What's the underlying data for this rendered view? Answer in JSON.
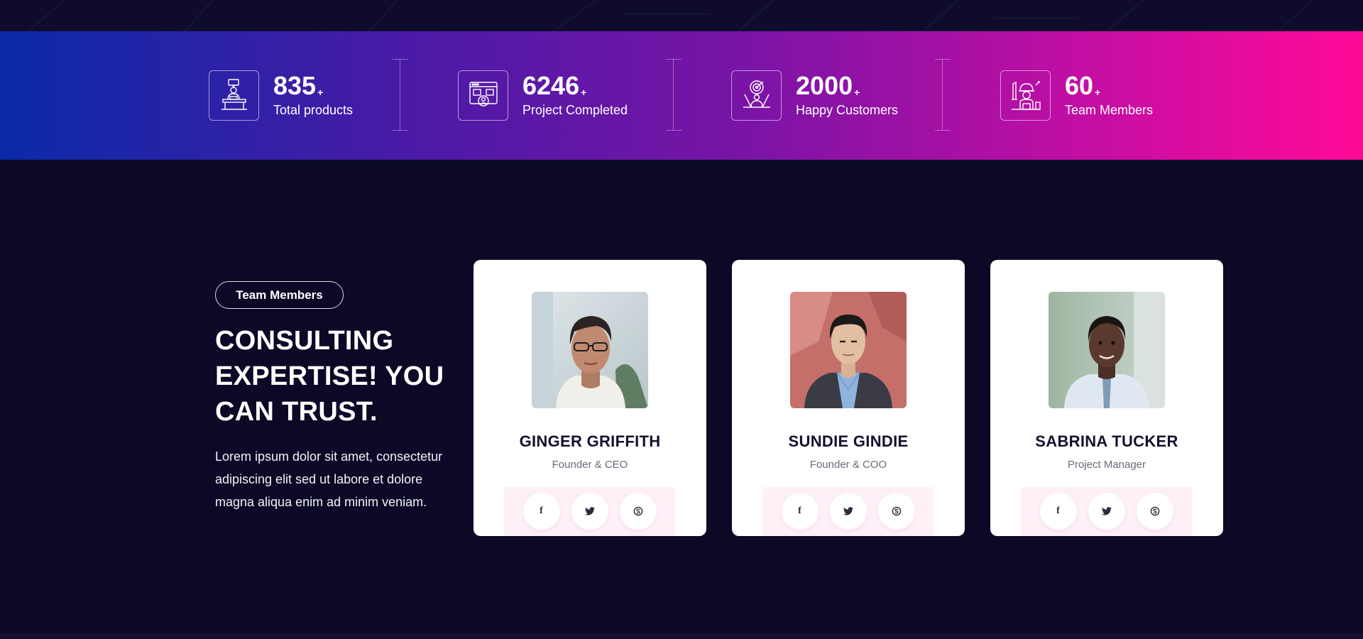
{
  "stats": [
    {
      "number": "835",
      "plus": "+",
      "label": "Total products",
      "icon": "presenter-desk-icon"
    },
    {
      "number": "6246",
      "plus": "+",
      "label": "Project Completed",
      "icon": "browser-user-icon"
    },
    {
      "number": "2000",
      "plus": "+",
      "label": "Happy Customers",
      "icon": "target-person-icon"
    },
    {
      "number": "60",
      "plus": "+",
      "label": "Team Members",
      "icon": "worker-tools-icon"
    }
  ],
  "team_section": {
    "badge": "Team Members",
    "headline": [
      "CONSULTING",
      "EXPERTISE! YOU",
      "CAN TRUST."
    ],
    "description": [
      "Lorem ipsum dolor sit amet, consectetur",
      "adipiscing elit sed ut labore et dolore",
      "magna aliqua enim ad minim veniam."
    ]
  },
  "members": [
    {
      "name": "GINGER GRIFFITH",
      "role": "Founder & CEO"
    },
    {
      "name": "SUNDIE GINDIE",
      "role": "Founder & COO"
    },
    {
      "name": "SABRINA TUCKER",
      "role": "Project Manager"
    }
  ],
  "social": {
    "facebook": "f",
    "twitter": "twitter-icon",
    "skype": "skype-icon"
  },
  "colors": {
    "background": "#0b0926",
    "gradient_start": "#0a2aa8",
    "gradient_end": "#ff0a98",
    "card_bg": "#ffffff",
    "social_bar_bg": "#fff0f8",
    "name_text": "#14122e"
  }
}
